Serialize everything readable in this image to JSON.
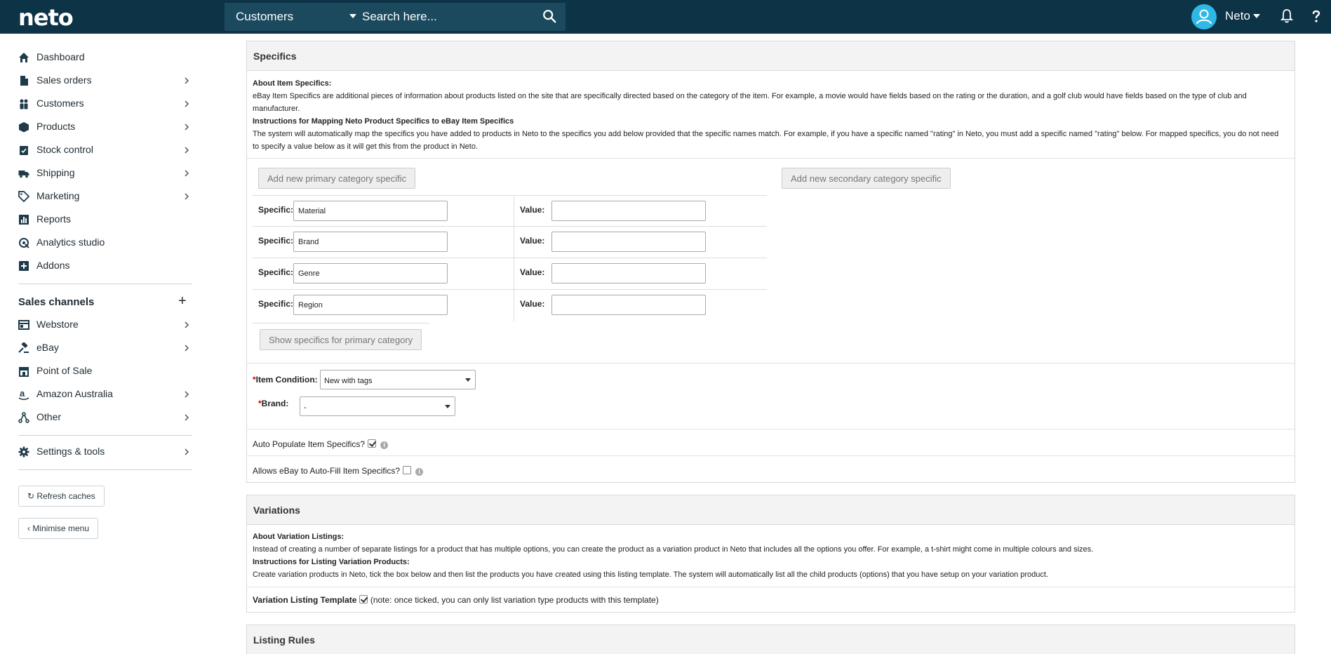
{
  "topbar": {
    "logo": "neto",
    "search_scope": "Customers",
    "search_placeholder": "Search here...",
    "user_name": "Neto"
  },
  "sidebar": {
    "items": [
      {
        "label": "Dashboard",
        "icon": "home-icon",
        "chevron": false
      },
      {
        "label": "Sales orders",
        "icon": "document-icon",
        "chevron": true
      },
      {
        "label": "Customers",
        "icon": "users-icon",
        "chevron": true
      },
      {
        "label": "Products",
        "icon": "box-icon",
        "chevron": true
      },
      {
        "label": "Stock control",
        "icon": "clipboard-check-icon",
        "chevron": true
      },
      {
        "label": "Shipping",
        "icon": "truck-icon",
        "chevron": true
      },
      {
        "label": "Marketing",
        "icon": "tag-icon",
        "chevron": true
      },
      {
        "label": "Reports",
        "icon": "bar-chart-icon",
        "chevron": false
      },
      {
        "label": "Analytics studio",
        "icon": "analytics-icon",
        "chevron": false
      },
      {
        "label": "Addons",
        "icon": "plus-square-icon",
        "chevron": false
      }
    ],
    "channels_heading": "Sales channels",
    "channels": [
      {
        "label": "Webstore",
        "icon": "browser-icon",
        "chevron": true
      },
      {
        "label": "eBay",
        "icon": "gavel-icon",
        "chevron": true
      },
      {
        "label": "Point of Sale",
        "icon": "store-icon",
        "chevron": false
      },
      {
        "label": "Amazon Australia",
        "icon": "amazon-icon",
        "chevron": true
      },
      {
        "label": "Other",
        "icon": "network-icon",
        "chevron": true
      }
    ],
    "settings_label": "Settings & tools",
    "refresh_label": "Refresh caches",
    "minimise_label": "Minimise menu"
  },
  "specifics": {
    "title": "Specifics",
    "about_heading": "About Item Specifics:",
    "about_text": "eBay Item Specifics are additional pieces of information about products listed on the site that are specifically directed based on the category of the item. For example, a movie would have fields based on the rating or the duration, and a golf club would have fields based on the type of club and manufacturer.",
    "instructions_heading": "Instructions for Mapping Neto Product Specifics to eBay Item Specifics",
    "instructions_text": "The system will automatically map the specifics you have added to products in Neto to the specifics you add below provided that the specific names match. For example, if you have a specific named \"rating\" in Neto, you must add a specific named \"rating\" below. For mapped specifics, you do not need to specify a value below as it will get this from the product in Neto.",
    "add_primary_label": "Add new primary category specific",
    "add_secondary_label": "Add new secondary category specific",
    "specific_label": "Specific:",
    "value_label": "Value:",
    "rows": [
      {
        "specific": "Material",
        "value": ""
      },
      {
        "specific": "Brand",
        "value": ""
      },
      {
        "specific": "Genre",
        "value": ""
      },
      {
        "specific": "Region",
        "value": ""
      }
    ],
    "show_specifics_label": "Show specifics for primary category",
    "required_mark": "*",
    "item_condition_label": "Item Condition:",
    "item_condition_value": "New with tags",
    "brand_label": "Brand:",
    "brand_value": "-",
    "auto_populate_label": "Auto Populate Item Specifics?",
    "auto_populate_checked": true,
    "auto_fill_label": "Allows eBay to Auto-Fill Item Specifics?",
    "auto_fill_checked": false
  },
  "variations": {
    "title": "Variations",
    "about_heading": "About Variation Listings:",
    "about_text": "Instead of creating a number of separate listings for a product that has multiple options, you can create the product as a variation product in Neto that includes all the options you offer. For example, a t-shirt might come in multiple colours and sizes.",
    "instructions_heading": "Instructions for Listing Variation Products:",
    "instructions_text": "Create variation products in Neto, tick the box below and then list the products you have created using this listing template. The system will automatically list all the child products (options) that you have setup on your variation product.",
    "template_label": "Variation Listing Template",
    "template_checked": true,
    "template_note": "(note: once ticked, you can only list variation type products with this template)"
  },
  "listing_rules": {
    "title": "Listing Rules"
  },
  "colors": {
    "topbar": "#0d3346",
    "search_bg": "#1b4a5f",
    "avatar": "#2fb8e6",
    "required": "#cc0000"
  }
}
